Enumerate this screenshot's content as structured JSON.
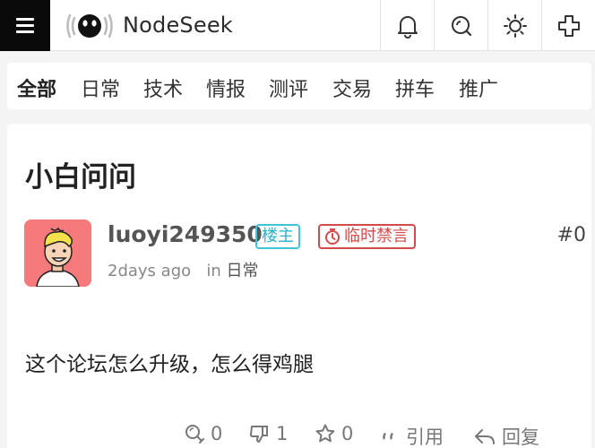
{
  "header": {
    "site_name": "NodeSeek",
    "icons": [
      "menu-icon",
      "nodeseek-logo",
      "bell-icon",
      "search-icon",
      "sun-icon",
      "plus-icon"
    ]
  },
  "categories": [
    "全部",
    "日常",
    "技术",
    "情报",
    "测评",
    "交易",
    "拼车",
    "推广"
  ],
  "post": {
    "title": "小白问问",
    "author": "luoyi249350",
    "op_badge": "楼主",
    "ban_badge": "临时禁言",
    "floor": "#0",
    "time": "2days ago",
    "in_label": "in",
    "category": "日常",
    "content": "这个论坛怎么升级，怎么得鸡腿",
    "actions": {
      "chicken": "0",
      "dislike": "1",
      "star": "0",
      "quote": "引用",
      "reply": "回复"
    }
  },
  "colors": {
    "header_menu_bg": "#0a0a0a",
    "op_badge": "#24b5c9",
    "ban_badge": "#d34a4a",
    "avatar_bg": "#f6797c"
  }
}
